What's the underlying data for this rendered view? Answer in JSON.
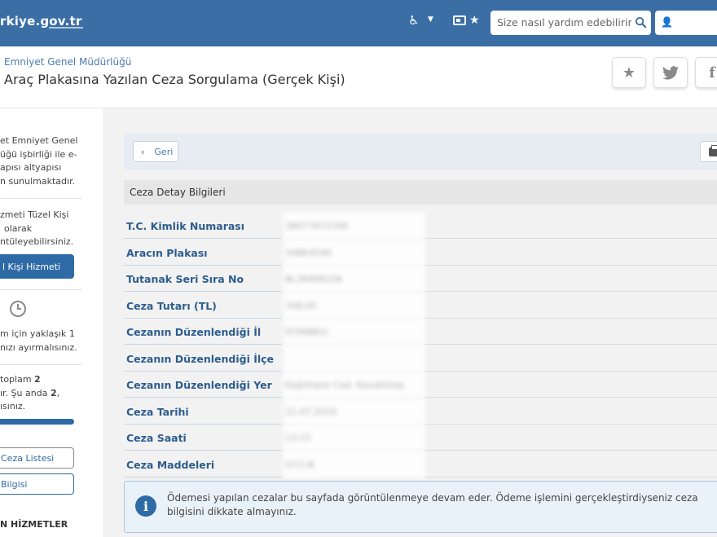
{
  "topbar": {
    "logo": "rkiye.gov.tr",
    "search": {
      "placeholder": "Size nasıl yardım edebilirim?"
    },
    "icons": [
      "accessibility-icon",
      "caret-down-icon",
      "id-card-icon",
      "star-icon",
      "search-icon",
      "user-icon"
    ]
  },
  "header": {
    "breadcrumb": "Emniyet Genel Müdürlüğü",
    "title": "Araç Plakasına Yazılan Ceza Sorgulama (Gerçek Kişi)",
    "fb_glyph": "f"
  },
  "sidebar": {
    "para1": [
      "et Emniyet Genel",
      "üğü işbirliği ile e-",
      "apısı altyapısı",
      "n sunulmaktadır."
    ],
    "para2": [
      "zmeti Tüzel Kişi",
      "olarak",
      "ntüleyebilirsiniz."
    ],
    "primary_button": "l Kişi Hizmeti",
    "para3": [
      "m için yaklaşık 1",
      "nızı ayırmalısınız."
    ],
    "para4_line1_prefix": "toplam ",
    "para4_line1_bold": "2",
    "para4_line2_prefix": "ır. Şu anda ",
    "para4_line2_bold": "2",
    "para4_line2_suffix": ",",
    "para4_line3": "ısınız.",
    "progress": 1.0,
    "button_list": "Ceza Listesi",
    "button_info": "Bilgisi",
    "section_title": "N HİZMETLER"
  },
  "main": {
    "back_label": "Geri",
    "section_title": "Ceza Detay Bilgileri",
    "rows": [
      {
        "label": "T.C. Kimlik Numarası",
        "value": "38077972348"
      },
      {
        "label": "Aracın Plakası",
        "value": "34BK4549"
      },
      {
        "label": "Tutanak Seri Sıra No",
        "value": "BL3848810A"
      },
      {
        "label": "Ceza Tutarı (TL)",
        "value": "708,00"
      },
      {
        "label": "Cezanın Düzenlendiği İl",
        "value": "İSTANBUL"
      },
      {
        "label": "Cezanın Düzenlendiği İlçe",
        "value": ""
      },
      {
        "label": "Cezanın Düzenlendiği Yer",
        "value": "Kağıthane Cad. Kavaklıbaş"
      },
      {
        "label": "Ceza Tarihi",
        "value": "21.07.2019"
      },
      {
        "label": "Ceza Saati",
        "value": "13:15"
      },
      {
        "label": "Ceza Maddeleri",
        "value": "47/1-B"
      }
    ],
    "notice": "Ödemesi yapılan cezalar bu sayfada görüntülenmeye devam eder. Ödeme işlemini gerçekleştirdiyseniz ceza bilgisini dikkate almayınız.",
    "notice_glyph": "i"
  },
  "colors": {
    "brand_blue": "#3a6ea5",
    "label_blue": "#2d5d8e",
    "button_blue": "#2e6aa5"
  }
}
